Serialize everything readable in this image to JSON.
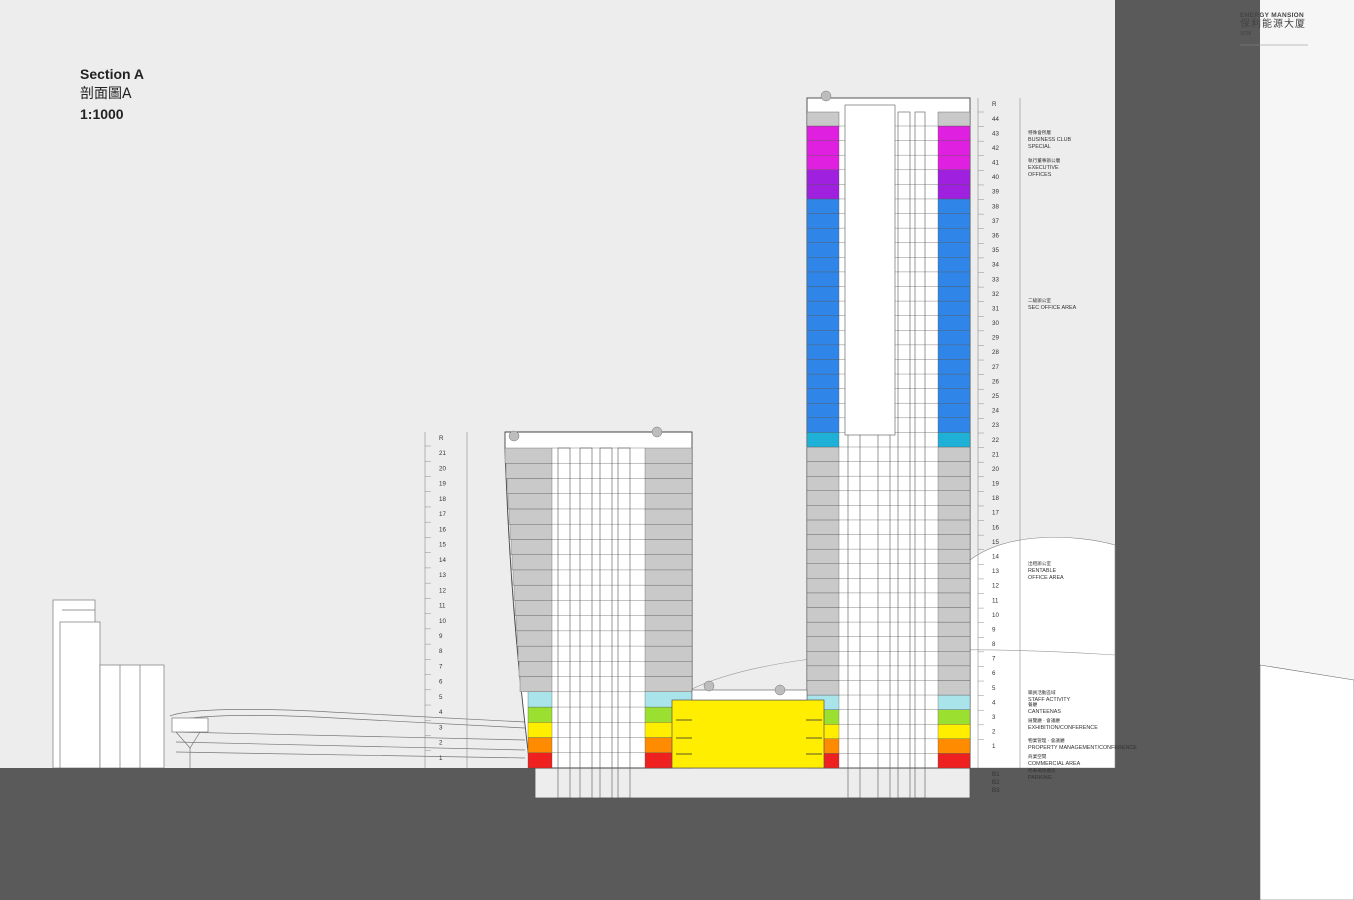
{
  "section": {
    "title": "Section A",
    "title_cn": "剖面圖A",
    "scale": "1:1000"
  },
  "brand": {
    "name_en": "ENERGY MANSION",
    "name_cn": "保利能源大厦",
    "sub": "SOM"
  },
  "colors": {
    "background": "#ededed",
    "ground": "#5a5a5a",
    "special": "#e020e0",
    "executive": "#a020e0",
    "office": "#2f86e8",
    "office_top": "#1fb0d8",
    "rentable": "#c9c9c9",
    "staff": "#a8e4ea",
    "canteen": "#9be030",
    "exhibition": "#ffee00",
    "property": "#ff8c00",
    "commercial": "#ee2020"
  },
  "tall_tower": {
    "roof_mark": "R",
    "floors": [
      "44",
      "43",
      "42",
      "41",
      "40",
      "39",
      "38",
      "37",
      "36",
      "35",
      "34",
      "33",
      "32",
      "31",
      "30",
      "29",
      "28",
      "27",
      "26",
      "25",
      "24",
      "23",
      "22",
      "21",
      "20",
      "19",
      "18",
      "17",
      "16",
      "15",
      "14",
      "13",
      "12",
      "11",
      "10",
      "9",
      "8",
      "7",
      "6",
      "5",
      "4",
      "3",
      "2",
      "1"
    ],
    "basement": [
      "B1",
      "B2",
      "B3"
    ]
  },
  "short_tower": {
    "roof_mark": "R",
    "floors": [
      "21",
      "20",
      "19",
      "18",
      "17",
      "16",
      "15",
      "14",
      "13",
      "12",
      "11",
      "10",
      "9",
      "8",
      "7",
      "6",
      "5",
      "4",
      "3",
      "2",
      "1"
    ]
  },
  "zones": [
    {
      "cn": "特殊會所層",
      "en": [
        "BUSINESS CLUB",
        "SPECIAL"
      ]
    },
    {
      "cn": "執行董事辦公層",
      "en": [
        "EXECUTIVE",
        "OFFICES"
      ]
    },
    {
      "cn": "二級辦公室",
      "en": [
        "SEC OFFICE AREA"
      ]
    },
    {
      "cn": "出租辦公室",
      "en": [
        "RENTABLE",
        "OFFICE AREA"
      ]
    },
    {
      "cn": "職員活動區域",
      "en": [
        "STAFF ACTIVITY"
      ]
    },
    {
      "cn": "餐廳",
      "en": [
        "CANTEENAS"
      ]
    },
    {
      "cn": "展覽廳 · 會議廳",
      "en": [
        "EXHIBITION/CONFERENCE"
      ]
    },
    {
      "cn": "物業管理 · 會議廳",
      "en": [
        "PROPERTY MANAGEMENT/CONFERENCE"
      ]
    },
    {
      "cn": "商業空間",
      "en": [
        "COMMERCIAL AREA"
      ]
    },
    {
      "cn": "停車場和機房",
      "en": [
        "PARKING"
      ]
    }
  ]
}
